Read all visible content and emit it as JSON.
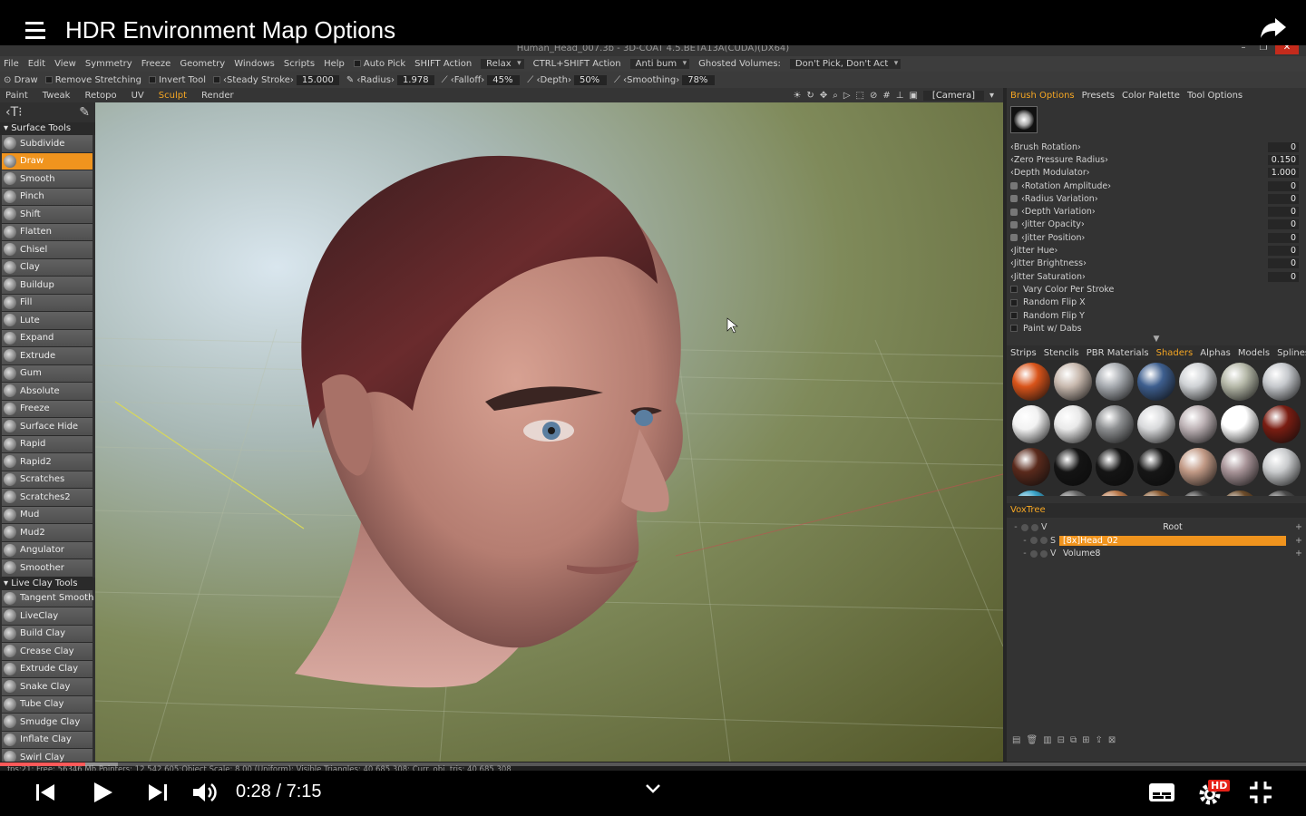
{
  "video": {
    "title": "HDR Environment Map Options",
    "time": "0:28 / 7:15",
    "progress": 0.065,
    "hd_badge": "HD"
  },
  "app": {
    "window_title": "Human_Head_007.3b - 3D-COAT 4.5.BETA13A(CUDA)(DX64)"
  },
  "menu": {
    "items": [
      "File",
      "Edit",
      "View",
      "Symmetry",
      "Freeze",
      "Geometry",
      "Windows",
      "Scripts",
      "Help"
    ],
    "auto_pick": "Auto Pick",
    "shift_action": "SHIFT Action",
    "relax": "Relax",
    "ctrl_shift_action": "CTRL+SHIFT Action",
    "anti_bump": "Anti bum",
    "ghosted_volumes": "Ghosted Volumes:",
    "dont_pick": "Don't Pick, Don't Act"
  },
  "toolbar": {
    "draw": "Draw",
    "remove_stretching": "Remove Stretching",
    "invert_tool": "Invert Tool",
    "steady_stroke_label": "Steady Stroke",
    "steady_stroke_value": "15.000",
    "radius_label": "Radius",
    "radius_value": "1.978",
    "falloff_label": "Falloff",
    "falloff_value": "45%",
    "depth_label": "Depth",
    "depth_value": "50%",
    "smoothing_label": "Smoothing",
    "smoothing_value": "78%"
  },
  "rooms": {
    "tabs": [
      "Paint",
      "Tweak",
      "Retopo",
      "UV",
      "Sculpt",
      "Render"
    ],
    "active": "Sculpt",
    "camera": "[Camera]"
  },
  "left_panel": {
    "surface_group": "Surface Tools",
    "surface_tools": [
      "Subdivide",
      "Draw",
      "Smooth",
      "Pinch",
      "Shift",
      "Flatten",
      "Chisel",
      "Clay",
      "Buildup",
      "Fill",
      "Lute",
      "Expand",
      "Extrude",
      "Gum",
      "Absolute",
      "Freeze",
      "Surface Hide",
      "Rapid",
      "Rapid2",
      "Scratches",
      "Scratches2",
      "Mud",
      "Mud2",
      "Angulator",
      "Smoother"
    ],
    "active_tool": "Draw",
    "live_group": "Live Clay Tools",
    "live_tools": [
      "Tangent Smooth",
      "LiveClay",
      "Build Clay",
      "Crease Clay",
      "Extrude Clay",
      "Snake Clay",
      "Tube Clay",
      "Smudge Clay",
      "Inflate Clay",
      "Swirl Clay"
    ]
  },
  "right_panel": {
    "tabs": [
      "Brush Options",
      "Presets",
      "Color Palette",
      "Tool Options"
    ],
    "active_tab": "Brush Options",
    "properties": [
      {
        "label": "Brush Rotation",
        "value": "0",
        "pen": false
      },
      {
        "label": "Zero Pressure Radius",
        "value": "0.150",
        "pen": false
      },
      {
        "label": "Depth Modulator",
        "value": "1.000",
        "pen": false
      },
      {
        "label": "Rotation Amplitude",
        "value": "0",
        "pen": true
      },
      {
        "label": "Radius Variation",
        "value": "0",
        "pen": true
      },
      {
        "label": "Depth Variation",
        "value": "0",
        "pen": true
      },
      {
        "label": "Jitter Opacity",
        "value": "0",
        "pen": true
      },
      {
        "label": "Jitter Position",
        "value": "0",
        "pen": true
      },
      {
        "label": "Jitter Hue",
        "value": "0",
        "pen": false
      },
      {
        "label": "Jitter Brightness",
        "value": "0",
        "pen": false
      },
      {
        "label": "Jitter Saturation",
        "value": "0",
        "pen": false
      }
    ],
    "checkboxes": [
      "Vary Color Per Stroke",
      "Random Flip X",
      "Random Flip Y",
      "Paint w/ Dabs"
    ],
    "library_tabs": [
      "Strips",
      "Stencils",
      "PBR Materials",
      "Shaders",
      "Alphas",
      "Models",
      "Splines"
    ],
    "active_library_tab": "Shaders",
    "shaders": [
      "#d9541a",
      "#c8b9ae",
      "#a7abb0",
      "#3e5f8f",
      "#cfd2d5",
      "#b5b8a8",
      "#c5c8cc",
      "#f2f2f2",
      "#e9e9e9",
      "#8d8f91",
      "#d8d9db",
      "#bdb2b5",
      "#ffffff",
      "#7a1d12",
      "#5a2a1c",
      "#141414",
      "#151515",
      "#161616",
      "#c29a86",
      "#a89498",
      "#c9cbcd",
      "#3aa3c8",
      "#666666",
      "#b9784a",
      "#8a5b32",
      "#3a3a3a",
      "#6b4b2a",
      "#4a4a4a"
    ],
    "voxtree_title": "VoxTree",
    "voxtree": [
      {
        "type": "V",
        "name": "Root",
        "selected": false,
        "indent": 0
      },
      {
        "type": "S",
        "name": "[8x]Head_02",
        "selected": true,
        "indent": 1
      },
      {
        "type": "V",
        "name": "Volume8",
        "selected": false,
        "indent": 1
      }
    ]
  },
  "status": {
    "text": "fps:21;   Free: 56346 Mb,Pointers: 12 542 605;Object Scale: 8.00 (Uniform); Visible Triangles: 40 685 308; Curr. obj. tris: 40 685 308"
  },
  "colors": {
    "accent": "#f0941e",
    "active_text": "#f5a623",
    "progress": "#ff0000"
  }
}
